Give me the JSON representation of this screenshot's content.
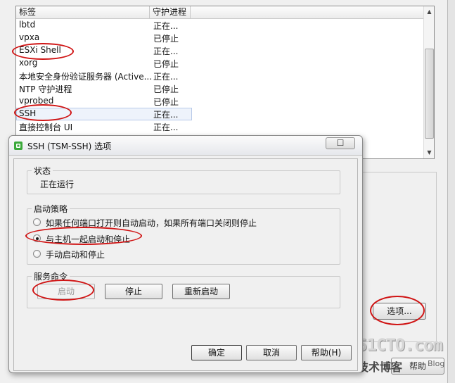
{
  "service_list": {
    "columns": [
      "标签",
      "守护进程"
    ],
    "rows": [
      {
        "label": "lbtd",
        "status": "正在..."
      },
      {
        "label": "vpxa",
        "status": "已停止"
      },
      {
        "label": "ESXi Shell",
        "status": "正在..."
      },
      {
        "label": "xorg",
        "status": "已停止"
      },
      {
        "label": "本地安全身份验证服务器 (Active...",
        "status": "正在..."
      },
      {
        "label": "NTP 守护进程",
        "status": "已停止"
      },
      {
        "label": "vprobed",
        "status": "已停止"
      },
      {
        "label": "SSH",
        "status": "正在..."
      },
      {
        "label": "直接控制台 UI",
        "status": "正在..."
      }
    ],
    "selected_row": "SSH"
  },
  "background": {
    "options_label": "选项...",
    "help_label": "帮助"
  },
  "watermark": {
    "main": "51CTO.com",
    "sub": "技术博客",
    "blog": "Blog"
  },
  "dialog": {
    "title": "SSH (TSM-SSH) 选项",
    "close_label": "☐",
    "status_group": {
      "title": "状态",
      "value": "正在运行"
    },
    "startup_group": {
      "title": "启动策略",
      "options": [
        {
          "label": "如果任何端口打开则自动启动，如果所有端口关闭则停止",
          "checked": false
        },
        {
          "label": "与主机一起启动和停止",
          "checked": true
        },
        {
          "label": "手动启动和停止",
          "checked": false
        }
      ]
    },
    "commands_group": {
      "title": "服务命令",
      "start_label": "启动",
      "stop_label": "停止",
      "restart_label": "重新启动"
    },
    "ok_label": "确定",
    "cancel_label": "取消",
    "help_label": "帮助(H)"
  },
  "colors": {
    "annotation_red": "#d01414",
    "selection_border": "#b7c9e8",
    "icon_green": "#3aa83a"
  }
}
